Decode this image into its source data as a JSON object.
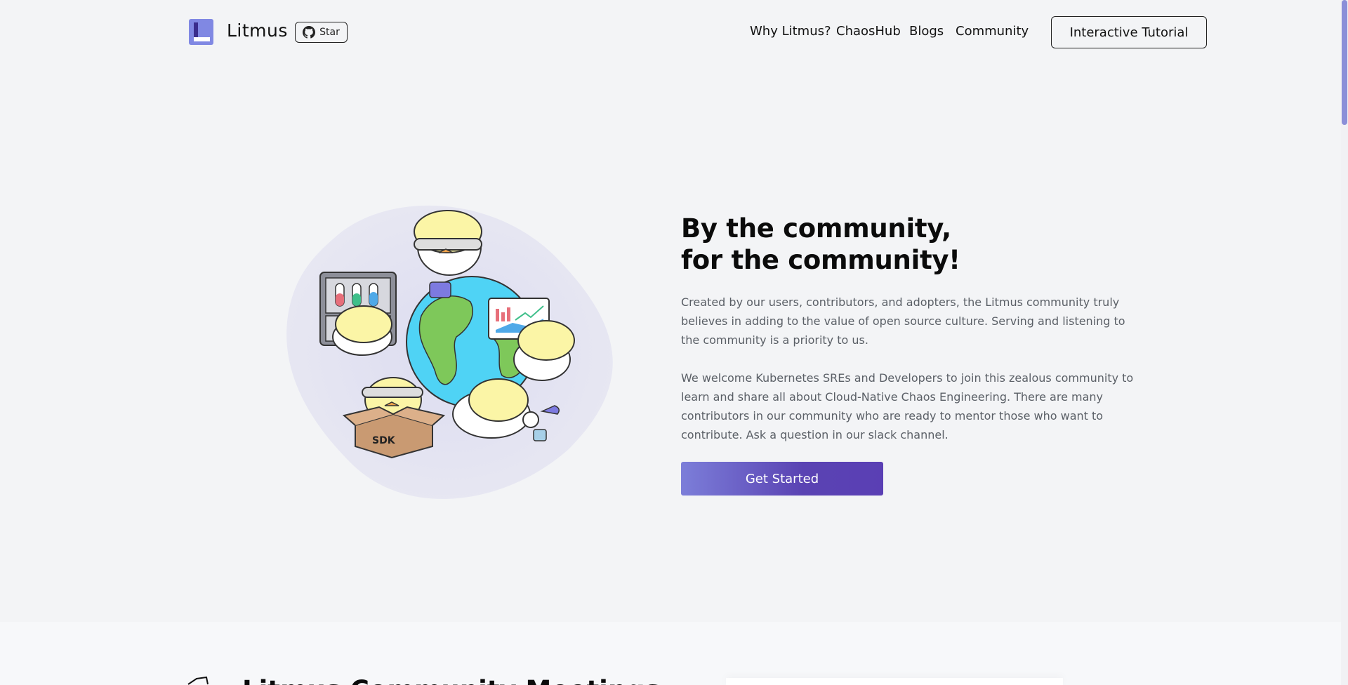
{
  "header": {
    "brand": "Litmus",
    "star_label": "Star",
    "nav": {
      "why": "Why Litmus?",
      "hub": "ChaosHub",
      "blogs": "Blogs",
      "community": "Community"
    },
    "tutorial_label": "Interactive Tutorial"
  },
  "hero": {
    "title_line1": "By the community,",
    "title_line2": "for the community!",
    "paragraph1": "Created by our users, contributors, and adopters, the Litmus community truly believes in adding to the value of open source culture. Serving and listening to the community is a priority to us.",
    "paragraph2": "We welcome Kubernetes SREs and Developers to join this zealous community to learn and share all about Cloud-Native Chaos Engineering. There are many contributors in our community who are ready to mentor those who want to contribute. Ask a question in our slack channel.",
    "cta_label": "Get Started",
    "illustration_box_label": "SDK"
  },
  "next_section": {
    "title_partial": "Litmus Community Meetings"
  },
  "colors": {
    "accent": "#5a43b3",
    "logo": "#8088e3",
    "background": "#f3f4f6"
  }
}
